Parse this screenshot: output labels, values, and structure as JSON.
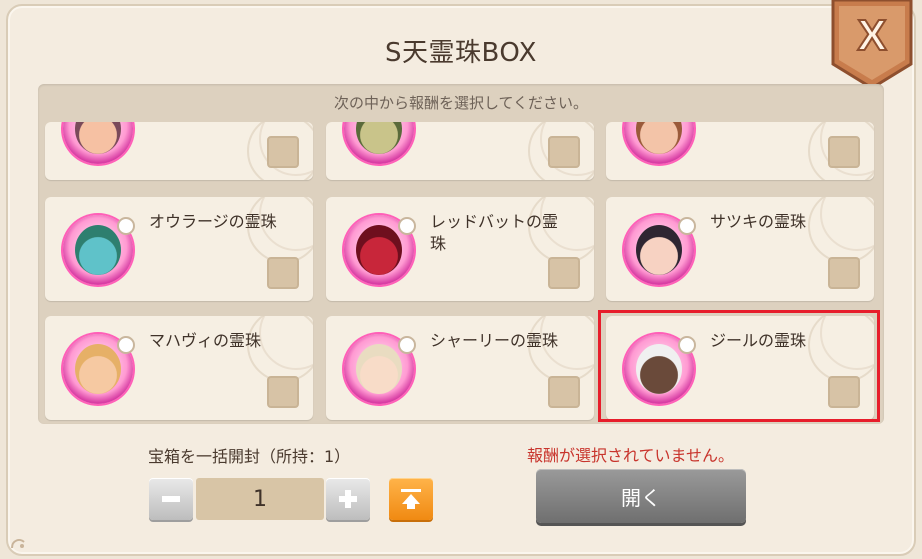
{
  "dialog": {
    "title": "S天霊珠BOX",
    "instruction": "次の中から報酬を選択してください。",
    "close_label": "X"
  },
  "items": [
    {
      "name": "",
      "art": "pink-hair-girl",
      "face": "#f6c1a3",
      "hair": "#7a4a5a"
    },
    {
      "name": "",
      "art": "green-armored",
      "face": "#c9c48a",
      "hair": "#5a6a3a"
    },
    {
      "name": "",
      "art": "brown-hair-girl",
      "face": "#f3c4a8",
      "hair": "#9a5a3a"
    },
    {
      "name": "オウラージの霊珠",
      "art": "blue-bird-beast",
      "face": "#5fc2c9",
      "hair": "#2e7f6f"
    },
    {
      "name": "レッドバットの霊珠",
      "art": "red-bat",
      "face": "#c8263a",
      "hair": "#6e0f1e"
    },
    {
      "name": "サツキの霊珠",
      "art": "dark-hair-girl",
      "face": "#f7d2c2",
      "hair": "#2e2632"
    },
    {
      "name": "マハヴィの霊珠",
      "art": "blonde-girl-wink",
      "face": "#f6c9a2",
      "hair": "#e6b067"
    },
    {
      "name": "シャーリーの霊珠",
      "art": "light-hair-girl",
      "face": "#f8dcc8",
      "hair": "#e9dcc1"
    },
    {
      "name": "ジールの霊珠",
      "art": "tan-girl-white-hood",
      "face": "#6a4a3a",
      "hair": "#f0f0f0"
    }
  ],
  "bulk": {
    "label": "宝箱を一括開封（所持：1）",
    "quantity": "1",
    "minus_icon": "minus-icon",
    "plus_icon": "plus-icon",
    "max_icon": "max-arrow-up-icon"
  },
  "status": {
    "warning": "報酬が選択されていません。"
  },
  "actions": {
    "open_label": "開く"
  },
  "colors": {
    "highlight": "#e71d2b",
    "warning": "#c8342c",
    "orb_pink": "#ff5fb8",
    "close_badge": "#c87c4c"
  }
}
